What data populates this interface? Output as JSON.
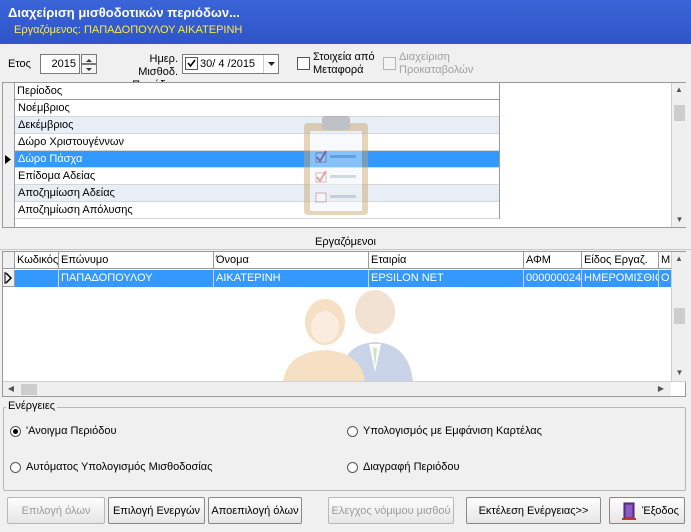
{
  "header": {
    "title": "Διαχείριση μισθοδοτικών περιόδων...",
    "subtitle": "Εργαζόμενος: ΠΑΠΑΔΟΠΟΥΛΟΥ ΑΙΚΑΤΕΡΙΝΗ"
  },
  "filters": {
    "year_label": "Ετος",
    "year_value": "2015",
    "date_label_1": "Ημερ. Μισθοδ.",
    "date_label_2": "Περιόδου",
    "date_value": "30/ 4 /2015",
    "transfer_label_1": "Στοιχεία από",
    "transfer_label_2": "Μεταφορά",
    "advances_label_1": "Διαχείριση",
    "advances_label_2": "Προκαταβολών"
  },
  "periods": {
    "header": "Περίοδος",
    "rows": [
      "Νοέμβριος",
      "Δεκέμβριος",
      "Δώρο Χριστουγέννων",
      "Δώρο Πάσχα",
      "Επίδομα Αδείας",
      "Αποζημίωση Αδείας",
      "Αποζημίωση Απόλυσης"
    ],
    "selected_index": 3
  },
  "employees": {
    "section_title": "Εργαζόμενοι",
    "columns": [
      "Κωδικός",
      "Επώνυμο",
      "Όνομα",
      "Εταιρία",
      "ΑΦΜ",
      "Είδος Εργαζ.",
      "Μ"
    ],
    "rows": [
      [
        "",
        "ΠΑΠΑΔΟΠΟΥΛΟΥ",
        "ΑΙΚΑΤΕΡΙΝΗ",
        "EPSILON NET",
        "000000024",
        "ΗΜΕΡΟΜΙΣΘΙΟ",
        "Ο"
      ]
    ]
  },
  "actions": {
    "group_title": "Ενέργειες",
    "options": [
      "'Ανοιγμα Περιόδου",
      "Υπολογισμός με Εμφάνιση Καρτέλας",
      "Αυτόματος Υπολογισμός Μισθοδοσίας",
      "Διαγραφή Περιόδου"
    ],
    "selected_index": 0
  },
  "buttons": {
    "select_all": "Επιλογή όλων",
    "select_active": "Επιλογή Ενεργών",
    "deselect_all": "Αποεπιλογή όλων",
    "check_legal": "Ελεγχος νόμιμου μισθού",
    "execute": "Εκτέλεση Ενέργειας>>",
    "exit": "Έξοδος"
  },
  "colors": {
    "header_bg": "#2f55c8",
    "subtitle": "#ffe84a",
    "selection": "#3399ff",
    "row_alt": "#e8eef6"
  },
  "icons": [
    "spin-up-icon",
    "spin-down-icon",
    "dropdown-arrow-icon",
    "row-pointer-icon",
    "clipboard-watermark-icon",
    "users-watermark-icon",
    "scroll-up-icon",
    "scroll-down-icon",
    "scroll-left-icon",
    "scroll-right-icon",
    "exit-door-icon"
  ]
}
